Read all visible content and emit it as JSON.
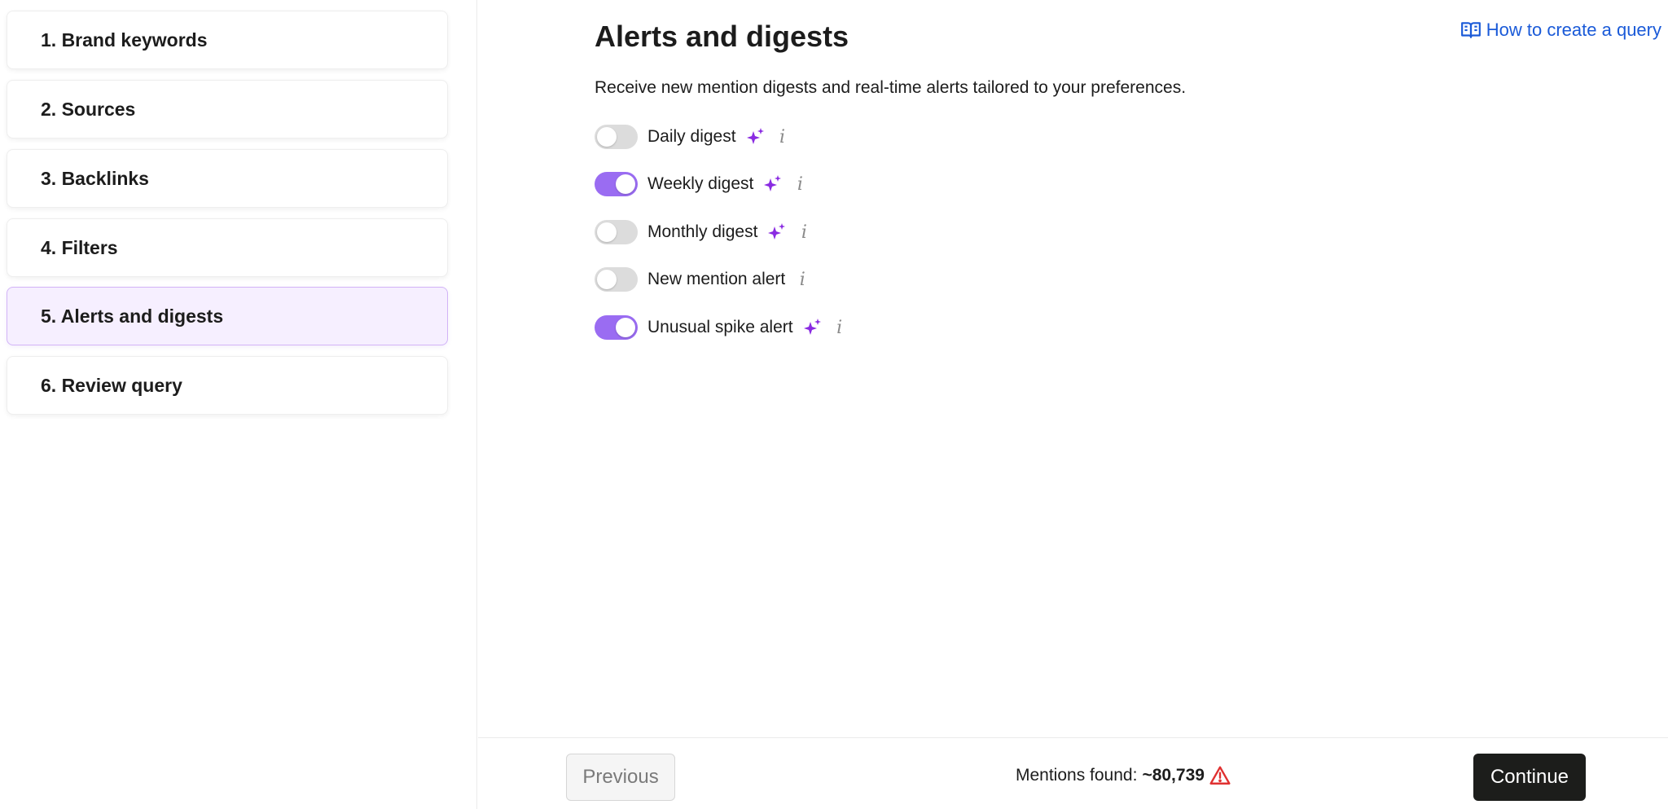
{
  "sidebar": {
    "steps": [
      {
        "label": "1. Brand keywords",
        "active": false
      },
      {
        "label": "2. Sources",
        "active": false
      },
      {
        "label": "3. Backlinks",
        "active": false
      },
      {
        "label": "4. Filters",
        "active": false
      },
      {
        "label": "5. Alerts and digests",
        "active": true
      },
      {
        "label": "6. Review query",
        "active": false
      }
    ]
  },
  "main": {
    "title": "Alerts and digests",
    "help_link": {
      "label": "How to create a query",
      "icon": "open-book-icon"
    },
    "description": "Receive new mention digests and real-time alerts tailored to your preferences.",
    "options": [
      {
        "label": "Daily digest",
        "enabled": false,
        "ai": true
      },
      {
        "label": "Weekly digest",
        "enabled": true,
        "ai": true
      },
      {
        "label": "Monthly digest",
        "enabled": false,
        "ai": true
      },
      {
        "label": "New mention alert",
        "enabled": false,
        "ai": false
      },
      {
        "label": "Unusual spike alert",
        "enabled": true,
        "ai": true
      }
    ],
    "info_glyph": "i"
  },
  "footer": {
    "previous_label": "Previous",
    "mentions_label": "Mentions found:",
    "mentions_count": "~80,739",
    "warning_icon": "warning-triangle-icon",
    "continue_label": "Continue"
  },
  "colors": {
    "accent": "#9a6cf2",
    "active_step_bg": "#f6efff",
    "active_step_border": "#d2b4f7",
    "link": "#1a5ad8",
    "sparkle": "#8a2be2",
    "warning": "#e03131",
    "continue_bg": "#1c1d1b"
  }
}
